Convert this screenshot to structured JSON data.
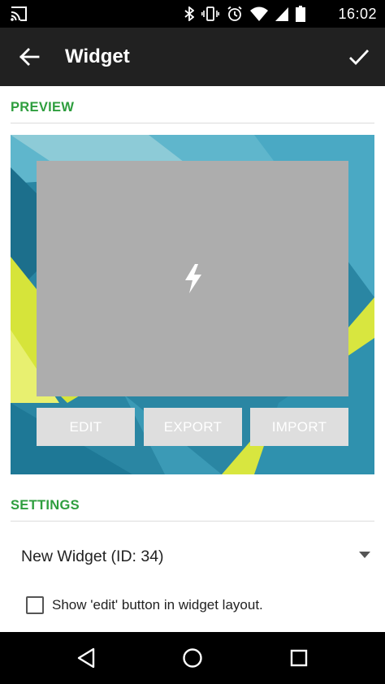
{
  "status_bar": {
    "time": "16:02",
    "icons": [
      "cast-icon",
      "bluetooth-icon",
      "vibrate-icon",
      "alarm-icon",
      "wifi-icon",
      "signal-icon",
      "battery-icon"
    ]
  },
  "toolbar": {
    "title": "Widget",
    "back_icon": "arrow-left-icon",
    "confirm_icon": "check-icon"
  },
  "preview": {
    "header": "PREVIEW",
    "widget_icon": "lightning-bolt-icon",
    "buttons": [
      "EDIT",
      "EXPORT",
      "IMPORT"
    ]
  },
  "settings": {
    "header": "SETTINGS",
    "widget_select": {
      "value": "New Widget (ID: 34)"
    },
    "show_edit_checkbox": {
      "label": "Show 'edit' button in widget layout.",
      "checked": false
    }
  },
  "nav_bar": {
    "icons": [
      "back-triangle-icon",
      "home-circle-icon",
      "recents-square-icon"
    ]
  },
  "colors": {
    "accent": "#2e9e3e",
    "toolbar": "#212121",
    "widget_bg": "#adadad",
    "button_bg": "#dedede"
  }
}
